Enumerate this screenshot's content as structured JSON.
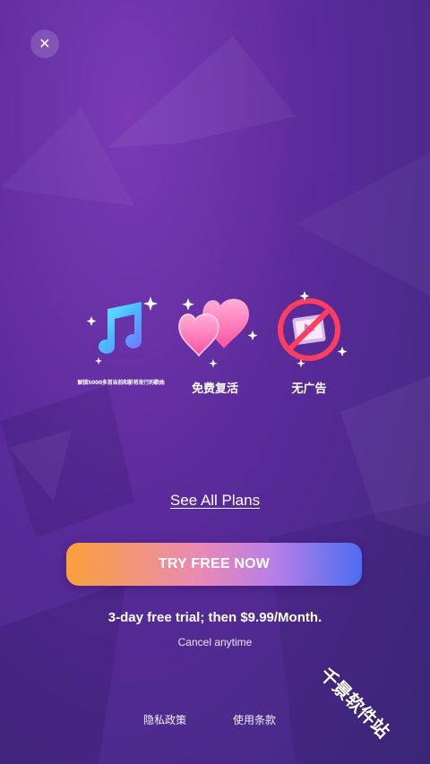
{
  "close": {
    "icon": "close-icon",
    "glyph": "✕"
  },
  "features": [
    {
      "icon": "music-note-icon",
      "label": "解锁5000多首当前和影将发行的歌曲"
    },
    {
      "icon": "hearts-icon",
      "label": "免费复活"
    },
    {
      "icon": "no-ads-icon",
      "label": "无广告"
    }
  ],
  "see_plans": "See All Plans",
  "cta": {
    "label": "TRY FREE NOW",
    "colors": [
      "#f9a13a",
      "#ea8ab5",
      "#b87ee8",
      "#4d6ef0"
    ]
  },
  "trial_text": "3-day free trial; then $9.99/Month.",
  "cancel_text": "Cancel anytime",
  "footer": {
    "privacy": "隐私政策",
    "terms": "使用条款"
  },
  "watermark": "千景软件站",
  "theme": {
    "background": "#5a2a9a",
    "accent_pink": "#ff6fb5",
    "accent_cyan": "#3fd0ff"
  }
}
